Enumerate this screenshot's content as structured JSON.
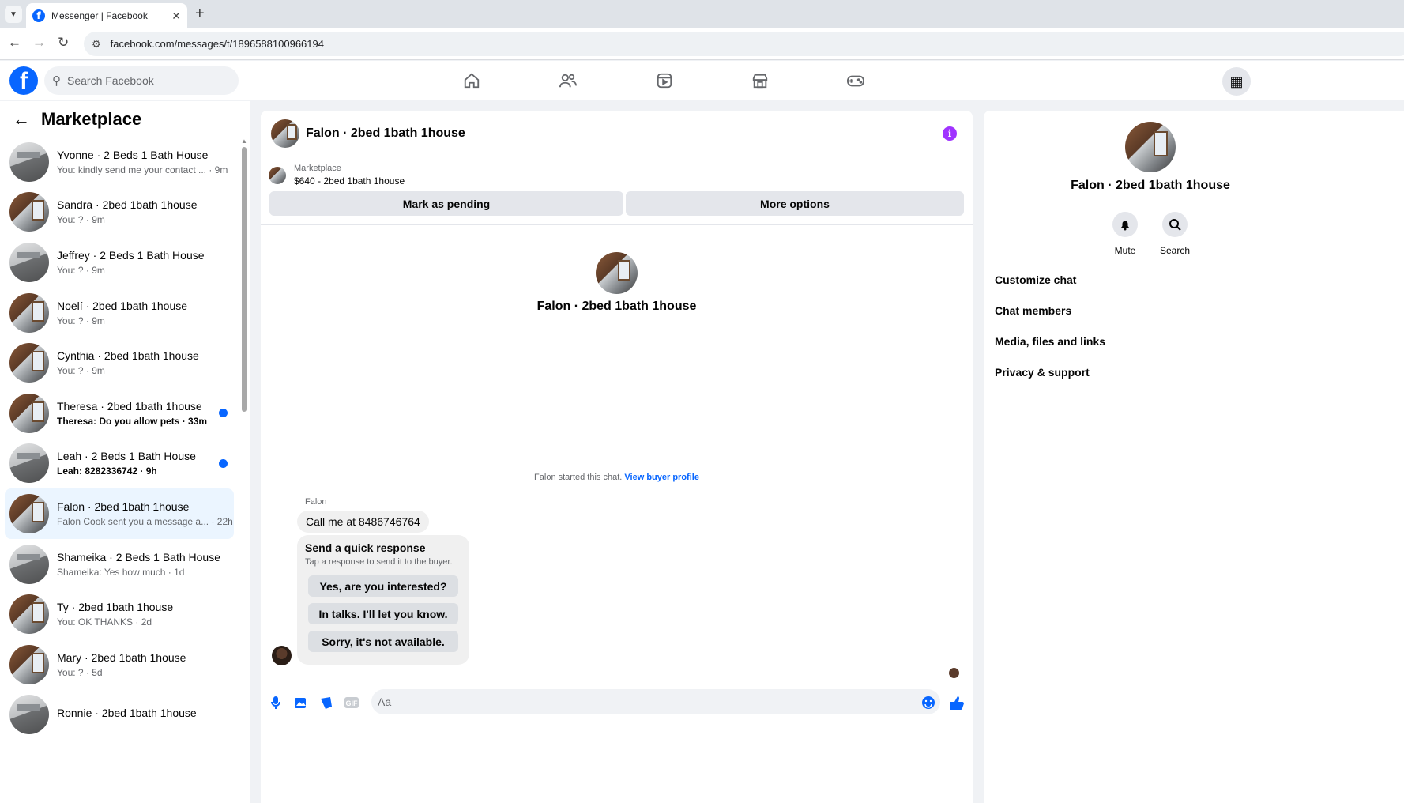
{
  "browser": {
    "tab_title": "Messenger | Facebook",
    "url": "facebook.com/messages/t/1896588100966194"
  },
  "fb": {
    "search_placeholder": "Search Facebook"
  },
  "sidebar": {
    "title": "Marketplace",
    "conversations": [
      {
        "name": "Yvonne · 2 Beds 1 Bath House",
        "snippet": "You: kindly send me your contact ... · 9m",
        "unread": false,
        "active": false
      },
      {
        "name": "Sandra · 2bed 1bath 1house",
        "snippet": "You: ? · 9m",
        "unread": false,
        "active": false
      },
      {
        "name": "Jeffrey · 2 Beds 1 Bath House",
        "snippet": "You: ? · 9m",
        "unread": false,
        "active": false
      },
      {
        "name": "Noelí · 2bed 1bath 1house",
        "snippet": "You: ? · 9m",
        "unread": false,
        "active": false
      },
      {
        "name": "Cynthia · 2bed 1bath 1house",
        "snippet": "You: ? · 9m",
        "unread": false,
        "active": false
      },
      {
        "name": "Theresa · 2bed 1bath 1house",
        "snippet": "Theresa: Do you allow pets · 33m",
        "unread": true,
        "active": false
      },
      {
        "name": "Leah · 2 Beds 1 Bath House",
        "snippet": "Leah: 8282336742 · 9h",
        "unread": true,
        "active": false
      },
      {
        "name": "Falon · 2bed 1bath 1house",
        "snippet": "Falon Cook sent you a message a... · 22h",
        "unread": false,
        "active": true
      },
      {
        "name": "Shameika · 2 Beds 1 Bath House",
        "snippet": "Shameika: Yes how much · 1d",
        "unread": false,
        "active": false
      },
      {
        "name": "Ty · 2bed 1bath 1house",
        "snippet": "You: OK THANKS · 2d",
        "unread": false,
        "active": false
      },
      {
        "name": "Mary · 2bed 1bath 1house",
        "snippet": "You: ? · 5d",
        "unread": false,
        "active": false
      },
      {
        "name": "Ronnie · 2bed 1bath 1house",
        "snippet": "",
        "unread": false,
        "active": false
      }
    ]
  },
  "chat": {
    "title": "Falon · 2bed 1bath 1house",
    "marketplace_label": "Marketplace",
    "listing": "$640 - 2bed 1bath 1house",
    "mark_pending": "Mark as pending",
    "more_options": "More options",
    "started_text": "Falon started this chat.",
    "view_profile": "View buyer profile",
    "sender": "Falon",
    "message": "Call me at 8486746764",
    "quick_title": "Send a quick response",
    "quick_sub": "Tap a response to send it to the buyer.",
    "quick_replies": [
      "Yes, are you interested?",
      "In talks. I'll let you know.",
      "Sorry, it's not available."
    ],
    "input_placeholder": "Aa"
  },
  "details": {
    "name": "Falon · 2bed 1bath 1house",
    "mute": "Mute",
    "search": "Search",
    "items": [
      "Customize chat",
      "Chat members",
      "Media, files and links",
      "Privacy & support"
    ]
  },
  "colors": {
    "accent": "#0866ff",
    "info": "#a033ff",
    "active_row": "#ebf5ff"
  }
}
